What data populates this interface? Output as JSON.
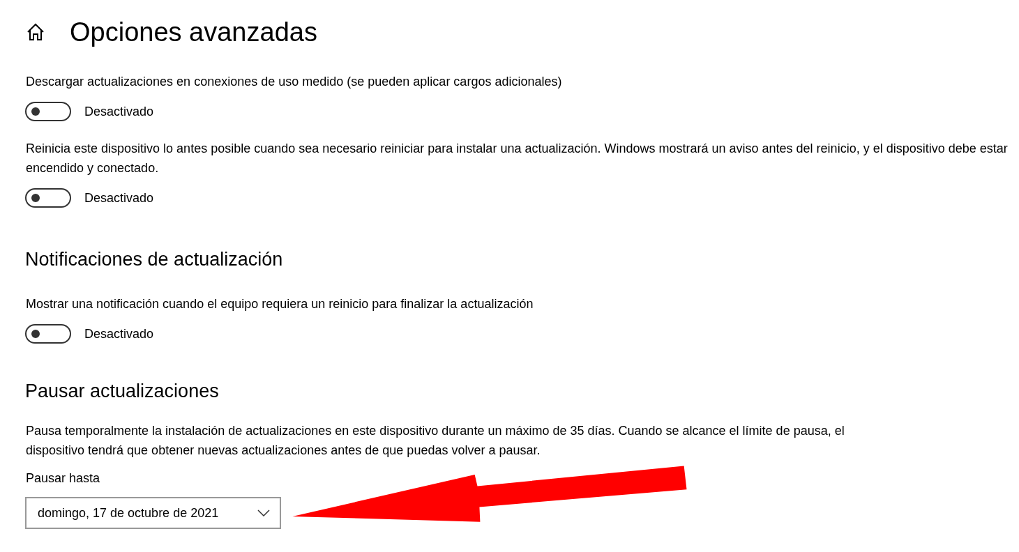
{
  "page": {
    "title": "Opciones avanzadas"
  },
  "sections": [
    {
      "kind": "toggles",
      "items": [
        {
          "description": "Descargar actualizaciones en conexiones de uso medido (se pueden aplicar cargos adicionales)",
          "on": false,
          "state_label": "Desactivado"
        },
        {
          "description": "Reinicia este dispositivo lo antes posible cuando sea necesario reiniciar para instalar una actualización. Windows mostrará un aviso antes del reinicio, y el dispositivo debe estar encendido y conectado.",
          "on": false,
          "state_label": "Desactivado"
        }
      ]
    },
    {
      "kind": "toggles",
      "heading": "Notificaciones de actualización",
      "items": [
        {
          "description": "Mostrar una notificación cuando el equipo requiera un reinicio para finalizar la actualización",
          "on": false,
          "state_label": "Desactivado"
        }
      ]
    },
    {
      "kind": "pause",
      "heading": "Pausar actualizaciones",
      "description": "Pausa temporalmente la instalación de actualizaciones en este dispositivo durante un máximo de 35 días. Cuando se alcance el límite de pausa, el dispositivo tendrá que obtener nuevas actualizaciones antes de que puedas volver a pausar.",
      "field_label": "Pausar hasta",
      "dropdown_value": "domingo, 17 de octubre de 2021"
    }
  ]
}
